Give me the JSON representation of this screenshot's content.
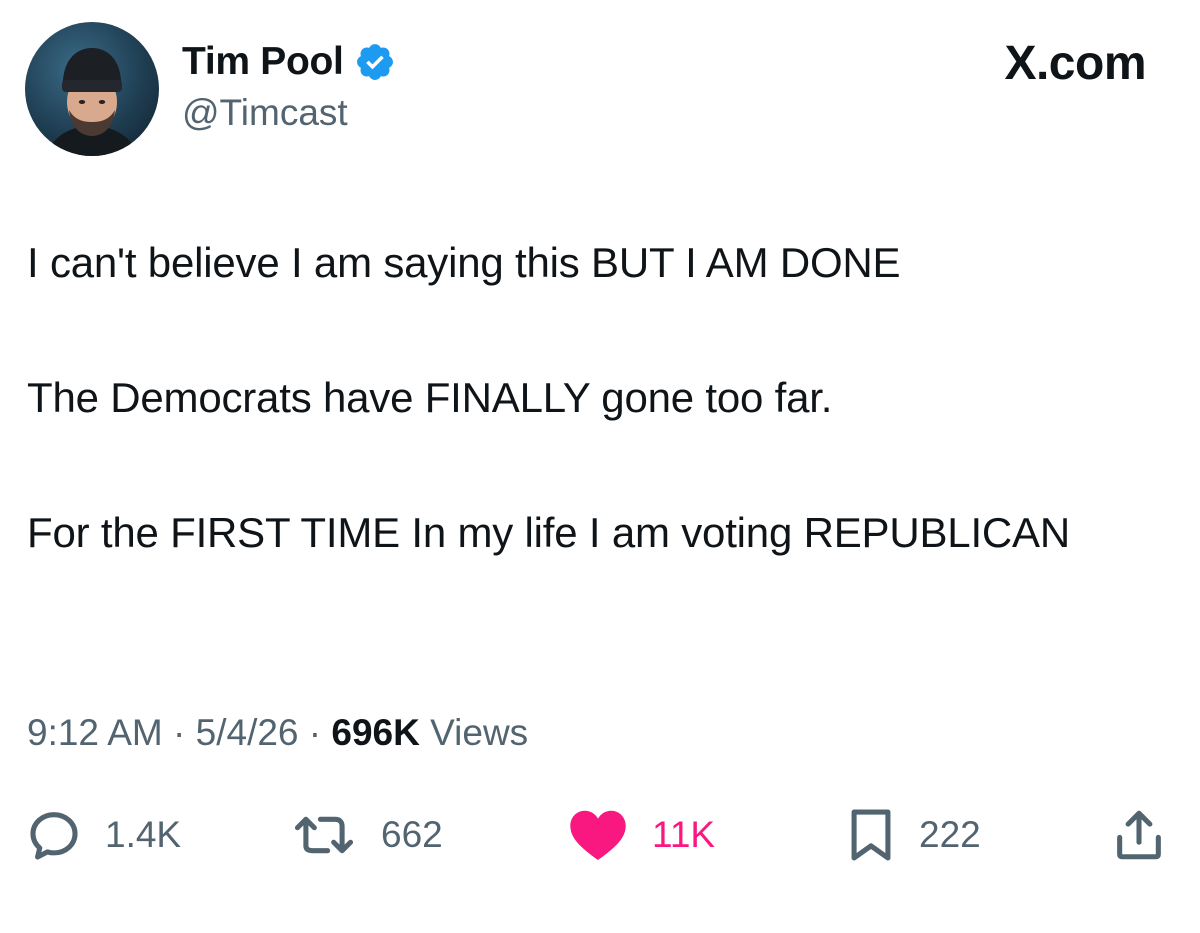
{
  "author": {
    "display_name": "Tim Pool",
    "handle": "@Timcast",
    "verified_icon": "verified-badge-icon",
    "verified_color": "#1d9bf0"
  },
  "brand": {
    "label": "X.com"
  },
  "tweet": {
    "paragraphs": [
      "I can't believe I am saying this BUT I AM DONE",
      "The Democrats have FINALLY gone too far.",
      "For the FIRST TIME In my life I am voting REPUBLICAN"
    ]
  },
  "meta": {
    "time": "9:12 AM",
    "separator": "·",
    "date": "5/4/26",
    "views_count": "696K",
    "views_label": "Views"
  },
  "actions": {
    "reply": {
      "icon": "reply-icon",
      "count": "1.4K"
    },
    "retweet": {
      "icon": "retweet-icon",
      "count": "662"
    },
    "like": {
      "icon": "heart-icon",
      "count": "11K",
      "color": "#f91880"
    },
    "bookmark": {
      "icon": "bookmark-icon",
      "count": "222"
    },
    "share": {
      "icon": "share-icon"
    }
  },
  "colors": {
    "text_primary": "#0f1419",
    "text_secondary": "#536471",
    "like_active": "#f91880"
  }
}
